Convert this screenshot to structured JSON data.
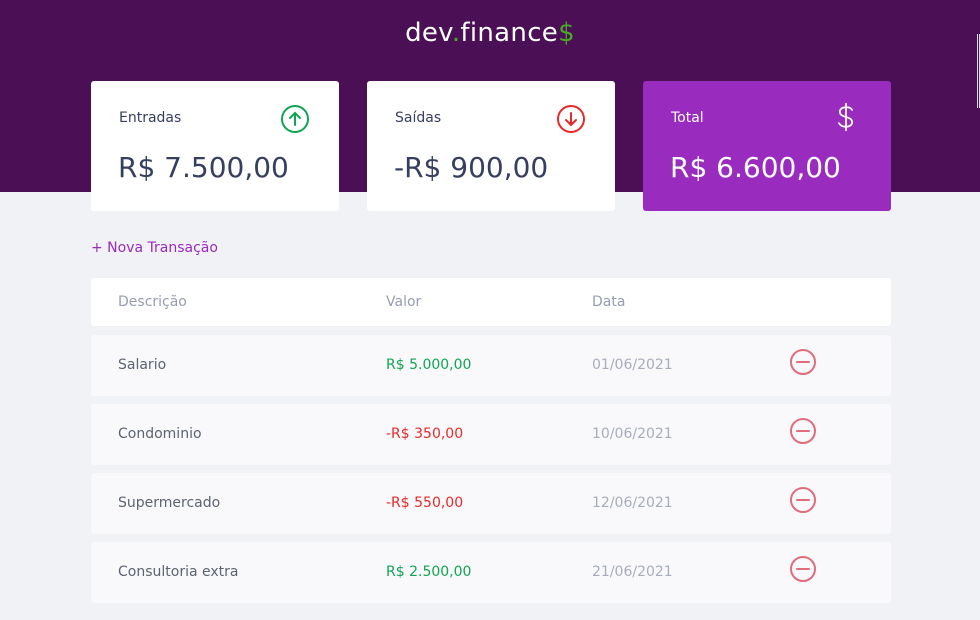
{
  "header": {
    "logo_prefix": "dev",
    "logo_dot": ".",
    "logo_mid": "finance",
    "logo_currency": "$"
  },
  "colors": {
    "header_bg": "#4a0f55",
    "income": "#12a454",
    "expense": "#e92929",
    "total_card": "#9a2bbf",
    "brand_green": "#49aa26"
  },
  "cards": {
    "income": {
      "label": "Entradas",
      "value": "R$ 7.500,00",
      "icon": "arrow-up-circle-icon"
    },
    "expense": {
      "label": "Saídas",
      "value": "-R$ 900,00",
      "icon": "arrow-down-circle-icon"
    },
    "total": {
      "label": "Total",
      "value": "R$ 6.600,00",
      "icon": "dollar-sign-icon"
    }
  },
  "actions": {
    "new_transaction": "+ Nova Transação"
  },
  "table": {
    "headers": [
      "Descrição",
      "Valor",
      "Data"
    ],
    "rows": [
      {
        "description": "Salario",
        "amount": "R$ 5.000,00",
        "type": "income",
        "date": "01/06/2021"
      },
      {
        "description": "Condominio",
        "amount": "-R$ 350,00",
        "type": "expense",
        "date": "10/06/2021"
      },
      {
        "description": "Supermercado",
        "amount": "-R$ 550,00",
        "type": "expense",
        "date": "12/06/2021"
      },
      {
        "description": "Consultoria extra",
        "amount": "R$ 2.500,00",
        "type": "income",
        "date": "21/06/2021"
      }
    ]
  }
}
